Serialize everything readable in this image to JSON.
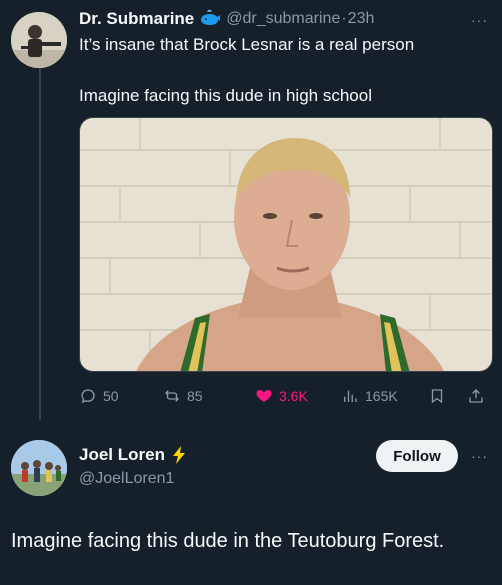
{
  "tweet": {
    "author_name": "Dr. Submarine",
    "author_handle": "@dr_submarine",
    "dot": "·",
    "time": "23h",
    "text_line1": "It’s insane that Brock Lesnar is a real person",
    "text_line2": "Imagine facing this dude in high school",
    "metrics": {
      "replies": "50",
      "reposts": "85",
      "likes": "3.6K",
      "views": "165K"
    }
  },
  "reply": {
    "author_name": "Joel Loren",
    "author_handle": "@JoelLoren1",
    "follow_label": "Follow",
    "text": "Imagine facing this dude in the Teutoburg Forest."
  },
  "more_glyph": "···",
  "colors": {
    "background": "#15202b",
    "like_pink": "#f91880",
    "muted": "#8b98a5",
    "verified_blue": "#1d9bf0",
    "lightning": "#ffd400"
  },
  "icons": [
    "reply-icon",
    "repost-icon",
    "heart-icon",
    "views-icon",
    "bookmark-icon",
    "share-icon",
    "whale-badge-icon",
    "lightning-icon"
  ]
}
